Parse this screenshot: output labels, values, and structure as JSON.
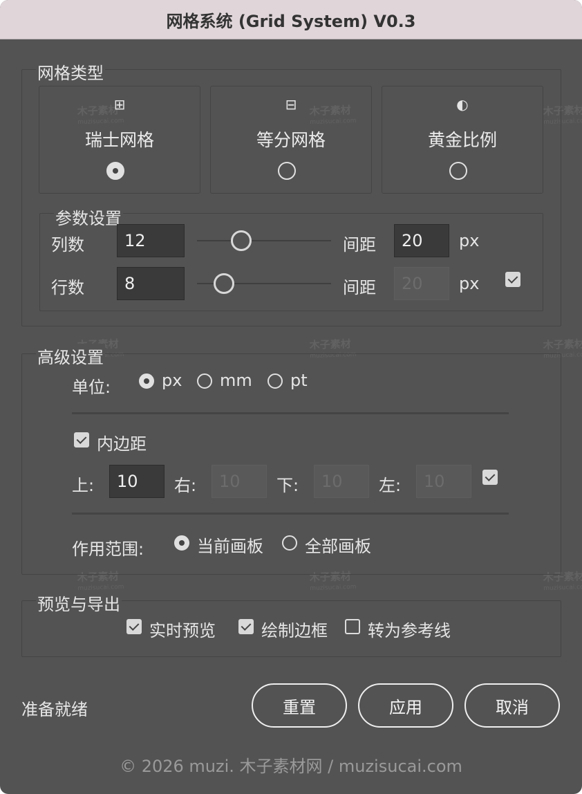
{
  "window": {
    "title": "网格系统 (Grid System) V0.3"
  },
  "grid_type": {
    "legend": "网格类型",
    "options": [
      {
        "glyph": "⊞",
        "icon": "grid-four-icon",
        "label": "瑞士网格",
        "selected": true
      },
      {
        "glyph": "⊟",
        "icon": "grid-split-icon",
        "label": "等分网格",
        "selected": false
      },
      {
        "glyph": "◐",
        "icon": "half-circle-icon",
        "label": "黄金比例",
        "selected": false
      }
    ]
  },
  "params": {
    "legend": "参数设置",
    "columns": {
      "label": "列数",
      "value": "12",
      "slider_fraction": 0.33,
      "gap_label": "间距",
      "gap_value": "20",
      "unit": "px"
    },
    "rows": {
      "label": "行数",
      "value": "8",
      "slider_fraction": 0.2,
      "gap_label": "间距",
      "gap_value": "20",
      "unit": "px",
      "link_checked": true
    }
  },
  "advanced": {
    "legend": "高级设置",
    "unit_label": "单位:",
    "units": [
      {
        "label": "px",
        "selected": true
      },
      {
        "label": "mm",
        "selected": false
      },
      {
        "label": "pt",
        "selected": false
      }
    ],
    "padding": {
      "label": "内边距",
      "checked": true,
      "top_label": "上:",
      "top_value": "10",
      "right_label": "右:",
      "right_value": "10",
      "bottom_label": "下:",
      "bottom_value": "10",
      "left_label": "左:",
      "left_value": "10",
      "link_checked": true
    },
    "scope_label": "作用范围:",
    "scopes": [
      {
        "label": "当前画板",
        "selected": true
      },
      {
        "label": "全部画板",
        "selected": false
      }
    ]
  },
  "preview": {
    "legend": "预览与导出",
    "options": [
      {
        "label": "实时预览",
        "checked": true
      },
      {
        "label": "绘制边框",
        "checked": true
      },
      {
        "label": "转为参考线",
        "checked": false
      }
    ]
  },
  "status": "准备就绪",
  "buttons": {
    "reset": "重置",
    "apply": "应用",
    "cancel": "取消"
  },
  "footer": "© 2026 muzi. 木子素材网 / muzisucai.com",
  "watermark": {
    "main": "木子素材",
    "sub": "muzisucai.com"
  },
  "colors": {
    "background": "#535353",
    "titlebar": "#e0d6d9",
    "text": "#e6e6e6"
  }
}
